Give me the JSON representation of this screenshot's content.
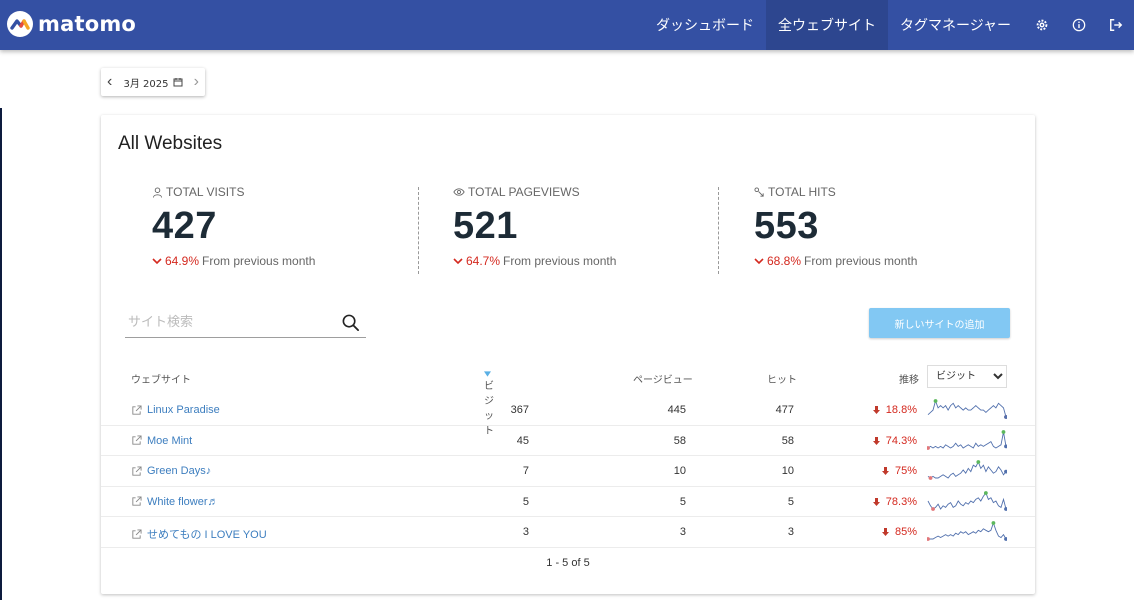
{
  "app": {
    "logo_text": "matomo"
  },
  "nav": {
    "dashboard": "ダッシュボード",
    "all_websites": "全ウェブサイト",
    "tag_manager": "タグマネージャー"
  },
  "period": {
    "label": "3月 2025"
  },
  "card": {
    "title": "All Websites"
  },
  "kpis": [
    {
      "label": "TOTAL VISITS",
      "icon": "user-icon",
      "value": "427",
      "change": "64.9%",
      "change_text": "From previous month"
    },
    {
      "label": "TOTAL PAGEVIEWS",
      "icon": "eye-icon",
      "value": "521",
      "change": "64.7%",
      "change_text": "From previous month"
    },
    {
      "label": "TOTAL HITS",
      "icon": "hits-icon",
      "value": "553",
      "change": "68.8%",
      "change_text": "From previous month"
    }
  ],
  "search": {
    "placeholder": "サイト検索"
  },
  "add_site_label": "新しいサイトの追加",
  "table": {
    "headers": {
      "website": "ウェブサイト",
      "visits": "ビジット",
      "pageviews": "ページビュー",
      "hits": "ヒット",
      "trend": "推移"
    },
    "trend_select_value": "ビジット",
    "rows": [
      {
        "site": "Linux Paradise",
        "visits": "367",
        "pageviews": "445",
        "hits": "477",
        "change": "18.8%",
        "spark": [
          3,
          4,
          5,
          9,
          6,
          7,
          6,
          7,
          5,
          7,
          8,
          6,
          7,
          6,
          5,
          6,
          5,
          5,
          6,
          7,
          6,
          5,
          5,
          4,
          5,
          6,
          7,
          6,
          8,
          7,
          6,
          2
        ]
      },
      {
        "site": "Moe Mint",
        "visits": "45",
        "pageviews": "58",
        "hits": "58",
        "change": "74.3%",
        "spark": [
          2,
          3,
          2,
          3,
          2,
          3,
          2,
          4,
          3,
          2,
          3,
          5,
          3,
          4,
          2,
          3,
          4,
          3,
          2,
          5,
          3,
          4,
          3,
          4,
          5,
          6,
          3,
          2,
          3,
          4,
          12,
          3
        ]
      },
      {
        "site": "Green Days♪",
        "visits": "7",
        "pageviews": "10",
        "hits": "10",
        "change": "75%",
        "spark": [
          3,
          2,
          3,
          2,
          2,
          3,
          4,
          3,
          2,
          4,
          5,
          3,
          4,
          5,
          7,
          5,
          8,
          6,
          10,
          9,
          12,
          8,
          10,
          6,
          9,
          7,
          5,
          6,
          9,
          7,
          4,
          6
        ]
      },
      {
        "site": "White flower♬",
        "visits": "5",
        "pageviews": "5",
        "hits": "5",
        "change": "78.3%",
        "spark": [
          8,
          5,
          3,
          4,
          6,
          3,
          5,
          4,
          6,
          7,
          4,
          5,
          8,
          6,
          5,
          7,
          6,
          8,
          7,
          9,
          10,
          8,
          11,
          13,
          9,
          10,
          7,
          8,
          5,
          4,
          9,
          3
        ]
      },
      {
        "site": "せめてもの I LOVE YOU",
        "visits": "3",
        "pageviews": "3",
        "hits": "3",
        "change": "85%",
        "spark": [
          3,
          3,
          3,
          4,
          5,
          4,
          5,
          6,
          5,
          6,
          5,
          7,
          6,
          8,
          7,
          8,
          6,
          7,
          8,
          7,
          9,
          8,
          10,
          9,
          8,
          9,
          14,
          9,
          5,
          4,
          6,
          3
        ]
      }
    ]
  },
  "pager": "1 - 5 of 5",
  "colors": {
    "header": "#3450a3",
    "header_active": "#2d468f",
    "link": "#3d7ebf",
    "negative": "#d4291f",
    "add_button": "#82c8f3",
    "spark_line": "#5170ad",
    "spark_max": "#5cb85c",
    "spark_min": "#e2777a"
  }
}
